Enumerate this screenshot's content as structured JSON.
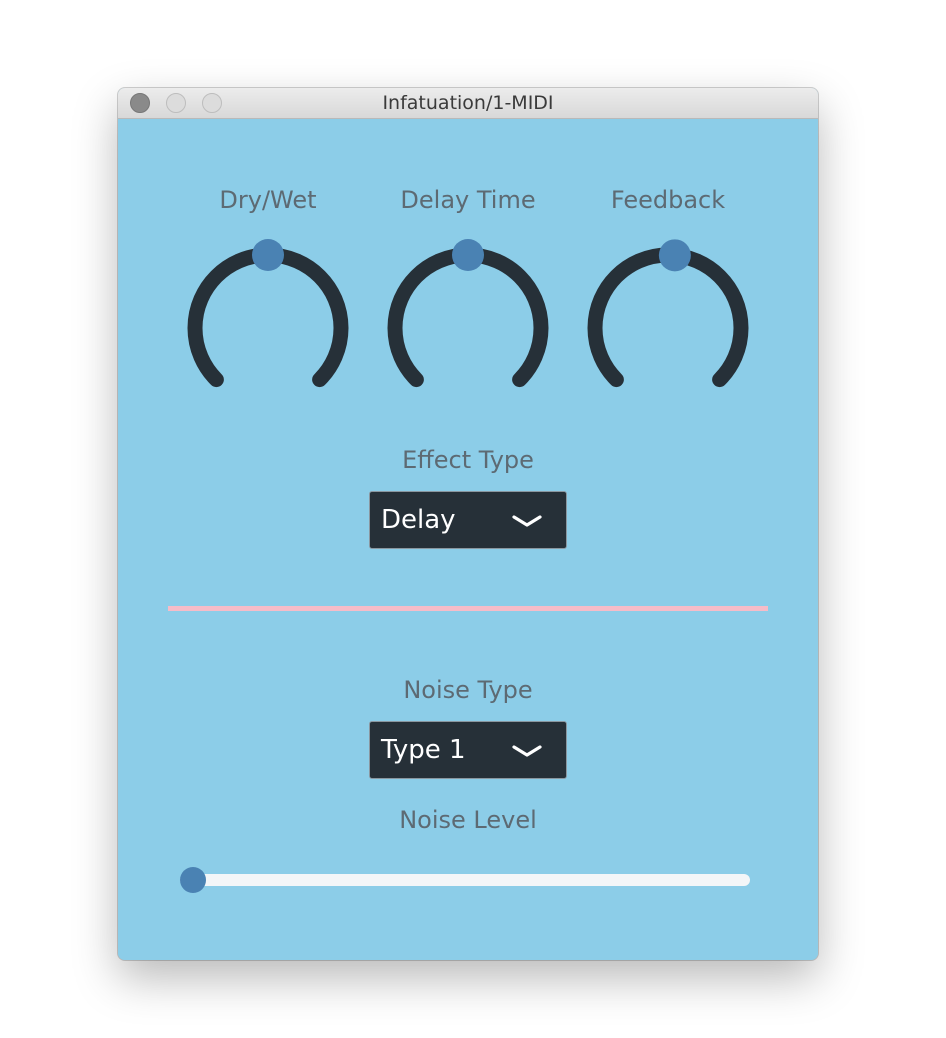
{
  "window": {
    "title": "Infatuation/1-MIDI"
  },
  "knobs": [
    {
      "label": "Dry/Wet",
      "value": 0.5
    },
    {
      "label": "Delay Time",
      "value": 0.5
    },
    {
      "label": "Feedback",
      "value": 0.52
    }
  ],
  "effect": {
    "label": "Effect Type",
    "selected": "Delay"
  },
  "noise": {
    "type_label": "Noise Type",
    "type_selected": "Type 1",
    "level_label": "Noise Level",
    "level_value": 0.0
  },
  "colors": {
    "background": "#8ccde8",
    "knob_track": "#263038",
    "knob_thumb": "#4a82b3",
    "label_text": "#5d6a73",
    "divider": "#f6bcc8",
    "slider_track": "#f3f6f8"
  },
  "icons": {
    "dropdown": "chevron-down-icon",
    "window_controls": [
      "close-icon",
      "minimize-icon",
      "maximize-icon"
    ]
  }
}
